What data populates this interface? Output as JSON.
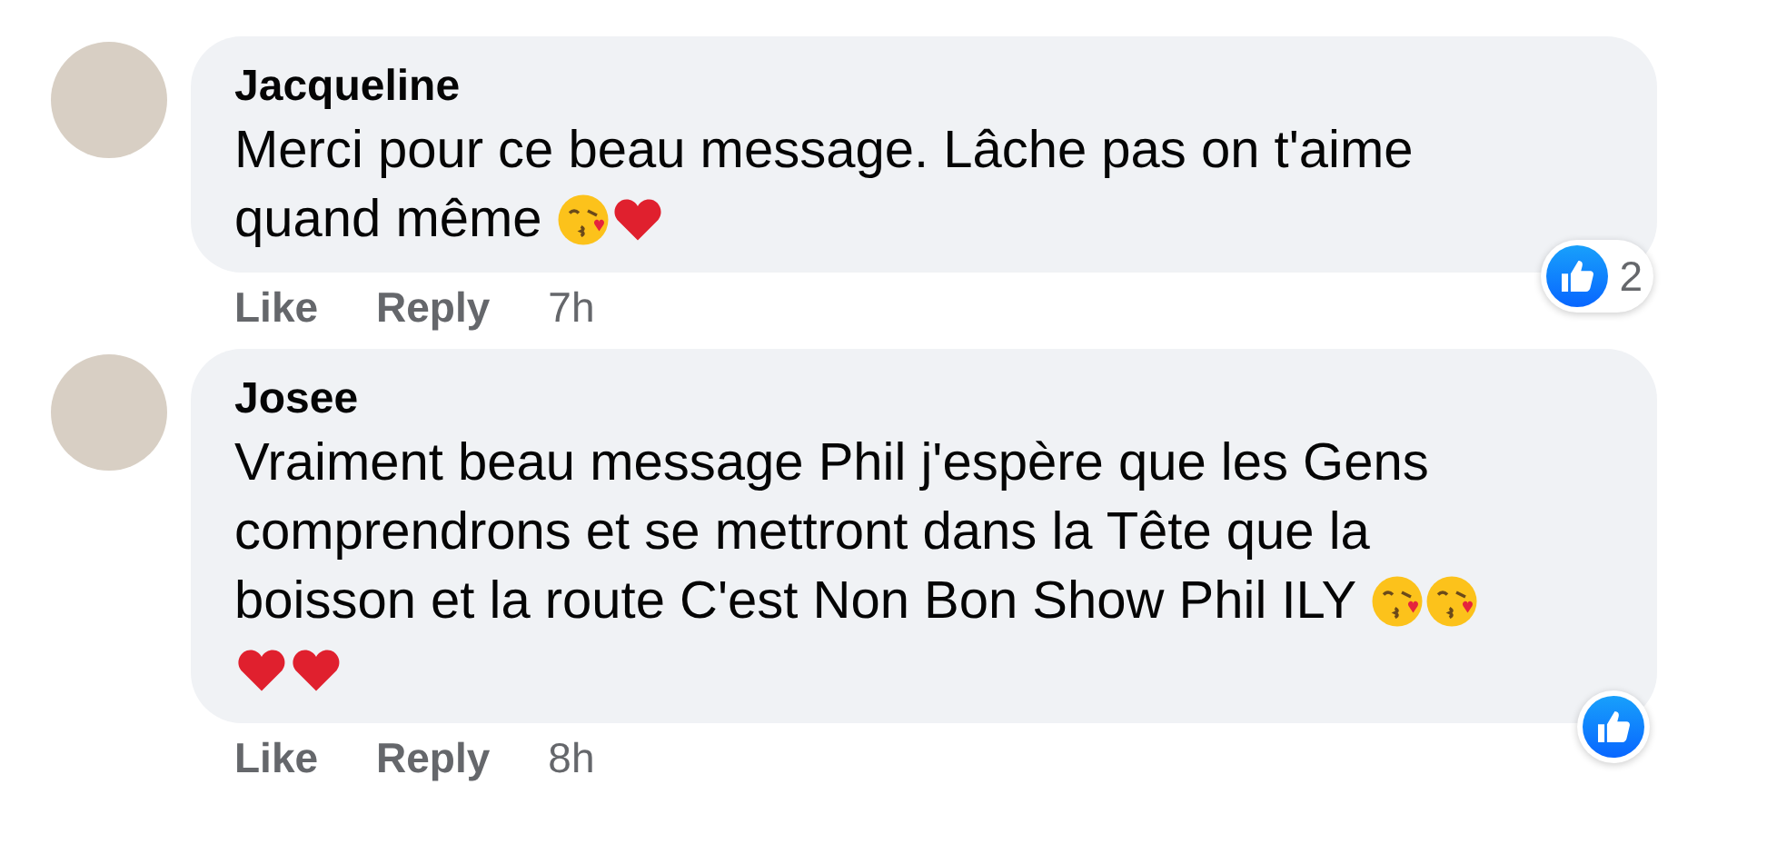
{
  "comments": [
    {
      "author": "Jacqueline",
      "body": [
        {
          "kind": "text",
          "text": "Merci pour ce beau message. Lâche pas on t'aime quand même "
        },
        {
          "kind": "kiss"
        },
        {
          "kind": "heart"
        }
      ],
      "reaction_count": "2",
      "actions": {
        "like": "Like",
        "reply": "Reply",
        "time": "7h"
      }
    },
    {
      "author": "Josee",
      "body": [
        {
          "kind": "text",
          "text": "Vraiment beau message Phil j'espère que les Gens comprendrons et se mettront dans la Tête que la boisson et la route C'est Non Bon Show Phil ILY "
        },
        {
          "kind": "kiss"
        },
        {
          "kind": "kiss"
        },
        {
          "kind": "heart"
        },
        {
          "kind": "heart"
        }
      ],
      "actions": {
        "like": "Like",
        "reply": "Reply",
        "time": "8h"
      }
    }
  ]
}
